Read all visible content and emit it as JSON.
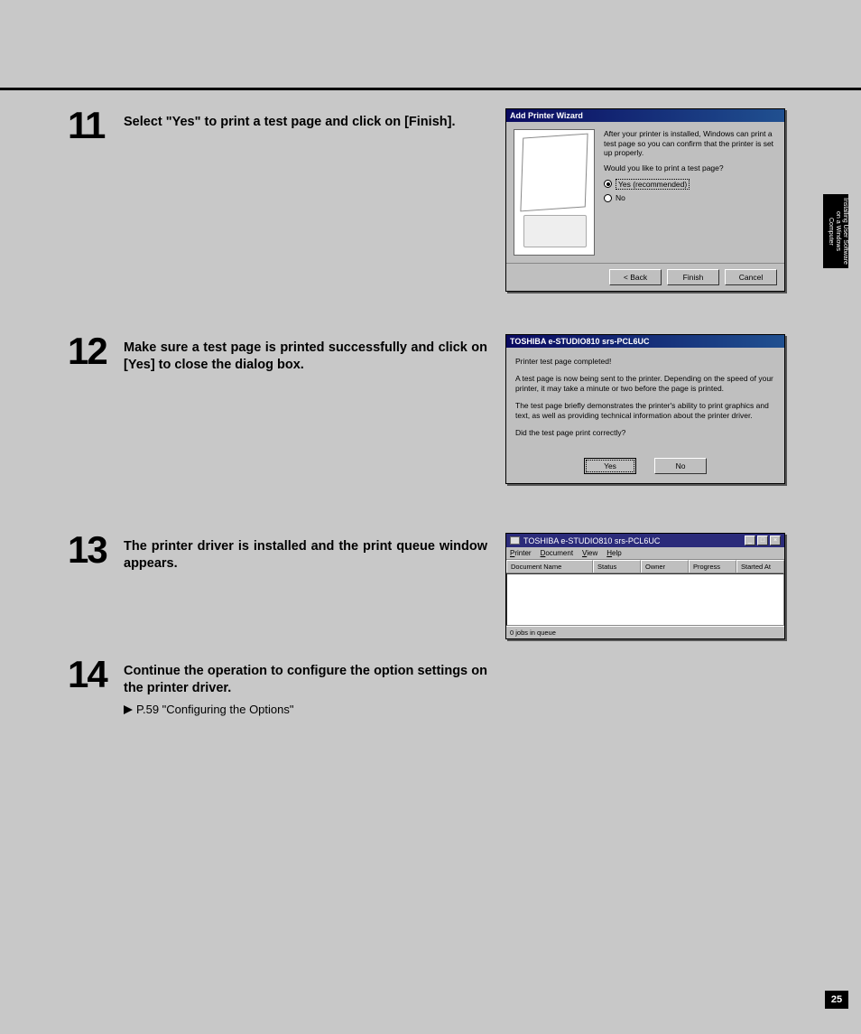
{
  "page_number": "25",
  "sidetab": "Installing User\nSoftware on a\nWindows Computer",
  "steps": [
    {
      "num": "11",
      "text": "Select \"Yes\" to print a test page and click on [Finish]."
    },
    {
      "num": "12",
      "text": "Make sure a test page is printed successfully and click on [Yes] to close the dialog box."
    },
    {
      "num": "13",
      "text": "The printer driver is installed and the print queue window appears."
    },
    {
      "num": "14",
      "text": "Continue the operation to configure the option settings on the printer driver.",
      "sub": "P.59 \"Configuring the Options\""
    }
  ],
  "dlg1": {
    "title": "Add Printer Wizard",
    "p1": "After your printer is installed, Windows can print a test page so you can confirm that the printer is set up properly.",
    "p2": "Would you like to print a test page?",
    "opt_yes": "Yes (recommended)",
    "opt_no": "No",
    "btn_back": "< Back",
    "btn_finish": "Finish",
    "btn_cancel": "Cancel"
  },
  "dlg2": {
    "title": "TOSHIBA e-STUDIO810 srs-PCL6UC",
    "p1": "Printer test page completed!",
    "p2": "A test page is now being sent to the printer. Depending on the speed of your printer, it may take a minute or two before the page is printed.",
    "p3": "The test page briefly demonstrates the printer's ability to print graphics and text, as well as providing technical information about the printer driver.",
    "p4": "Did the test page print correctly?",
    "btn_yes": "Yes",
    "btn_no": "No"
  },
  "win3": {
    "title": "TOSHIBA e-STUDIO810 srs-PCL6UC",
    "menu": {
      "printer": "Printer",
      "document": "Document",
      "view": "View",
      "help": "Help"
    },
    "cols": {
      "c1": "Document Name",
      "c2": "Status",
      "c3": "Owner",
      "c4": "Progress",
      "c5": "Started At"
    },
    "status": "0 jobs in queue"
  }
}
